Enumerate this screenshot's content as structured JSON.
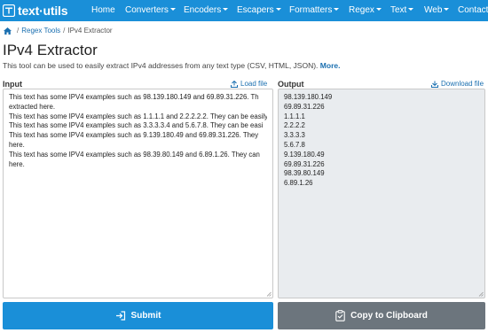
{
  "navbar": {
    "brand": "text·utils",
    "items": [
      {
        "label": "Home",
        "dropdown": false
      },
      {
        "label": "Converters",
        "dropdown": true
      },
      {
        "label": "Encoders",
        "dropdown": true
      },
      {
        "label": "Escapers",
        "dropdown": true
      },
      {
        "label": "Formatters",
        "dropdown": true
      },
      {
        "label": "Regex",
        "dropdown": true
      },
      {
        "label": "Text",
        "dropdown": true
      },
      {
        "label": "Web",
        "dropdown": true
      },
      {
        "label": "Contact",
        "dropdown": false
      }
    ]
  },
  "breadcrumb": {
    "sep": "/",
    "items": [
      "Regex Tools",
      "IPv4 Extractor"
    ]
  },
  "page": {
    "title": "IPv4 Extractor",
    "description": "This tool can be used to easily extract IPv4 addresses from any text type (CSV, HTML, JSON).",
    "more_link": "More."
  },
  "input": {
    "label": "Input",
    "action": "Load file",
    "lines": [
      "This text has some IPV4 examples such as 98.139.180.149 and 69.89.31.226. Th",
      "extracted here.",
      "This text has some IPV4 examples such as 1.1.1.1 and 2.2.2.2.2. They can be easily",
      "This text has some IPV4 examples such as 3.3.3.3.4 and 5.6.7.8. They can be easi",
      "This text has some IPV4 examples such as 9.139.180.49 and 69.89.31.226. They",
      "here.",
      "This text has some IPV4 examples such as 98.39.80.149 and 6.89.1.26. They can",
      "here."
    ]
  },
  "output": {
    "label": "Output",
    "action": "Download file",
    "lines": [
      "98.139.180.149",
      "69.89.31.226",
      "1.1.1.1",
      "2.2.2.2",
      "3.3.3.3",
      "5.6.7.8",
      "9.139.180.49",
      "69.89.31.226",
      "98.39.80.149",
      "6.89.1.26"
    ]
  },
  "buttons": {
    "submit": "Submit",
    "copy": "Copy to Clipboard"
  },
  "colors": {
    "primary": "#1a8fd8",
    "secondary": "#6c757d",
    "link": "#1a6fb0"
  }
}
